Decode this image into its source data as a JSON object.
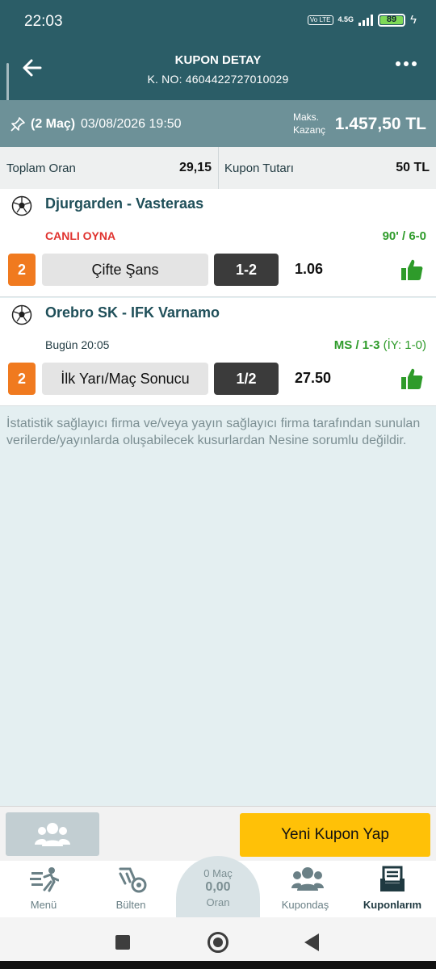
{
  "status": {
    "time": "22:03",
    "volte": "Vo LTE",
    "network": "4.5G",
    "battery": "89"
  },
  "header": {
    "title": "KUPON DETAY",
    "coupon_no": "K. NO: 4604422727010029"
  },
  "summary": {
    "match_count": "(2 Maç)",
    "datetime": "03/08/2026 19:50",
    "max_label_line1": "Maks.",
    "max_label_line2": "Kazanç",
    "max_win": "1.457,50 TL"
  },
  "totals": {
    "total_odds_label": "Toplam Oran",
    "total_odds": "29,15",
    "coupon_amount_label": "Kupon Tutarı",
    "coupon_amount": "50 TL"
  },
  "matches": [
    {
      "teams": "Djurgarden - Vasteraas",
      "status": "CANLI OYNA",
      "status_color": "#e0322e",
      "result": "90' / 6-0",
      "result_extra": "",
      "mbs": "2",
      "market": "Çifte Şans",
      "pick": "1-2",
      "odd": "1.06"
    },
    {
      "teams": "Orebro SK - IFK Varnamo",
      "status": "Bugün 20:05",
      "status_color": "#1f3940",
      "result": "MS / 1-3",
      "result_extra": " (İY: 1-0)",
      "mbs": "2",
      "market": "İlk Yarı/Maç Sonucu",
      "pick": "1/2",
      "odd": "27.50"
    }
  ],
  "disclaimer": "İstatistik sağlayıcı firma ve/veya yayın sağlayıcı firma tarafından sunulan verilerde/yayınlarda oluşabilecek kusurlardan Nesine sorumlu değildir.",
  "actions": {
    "new_coupon": "Yeni Kupon Yap"
  },
  "nav": {
    "menu": "Menü",
    "bulletin": "Bülten",
    "center_matches": "0 Maç",
    "center_odds": "0,00",
    "center_label": "Oran",
    "kupondas": "Kupondaş",
    "kuponlarim": "Kuponlarım"
  },
  "colors": {
    "header": "#2b5d67",
    "summary": "#6d9198",
    "accent_orange": "#f07a1f",
    "win_green": "#2e9b2a",
    "cta_yellow": "#ffc107"
  }
}
